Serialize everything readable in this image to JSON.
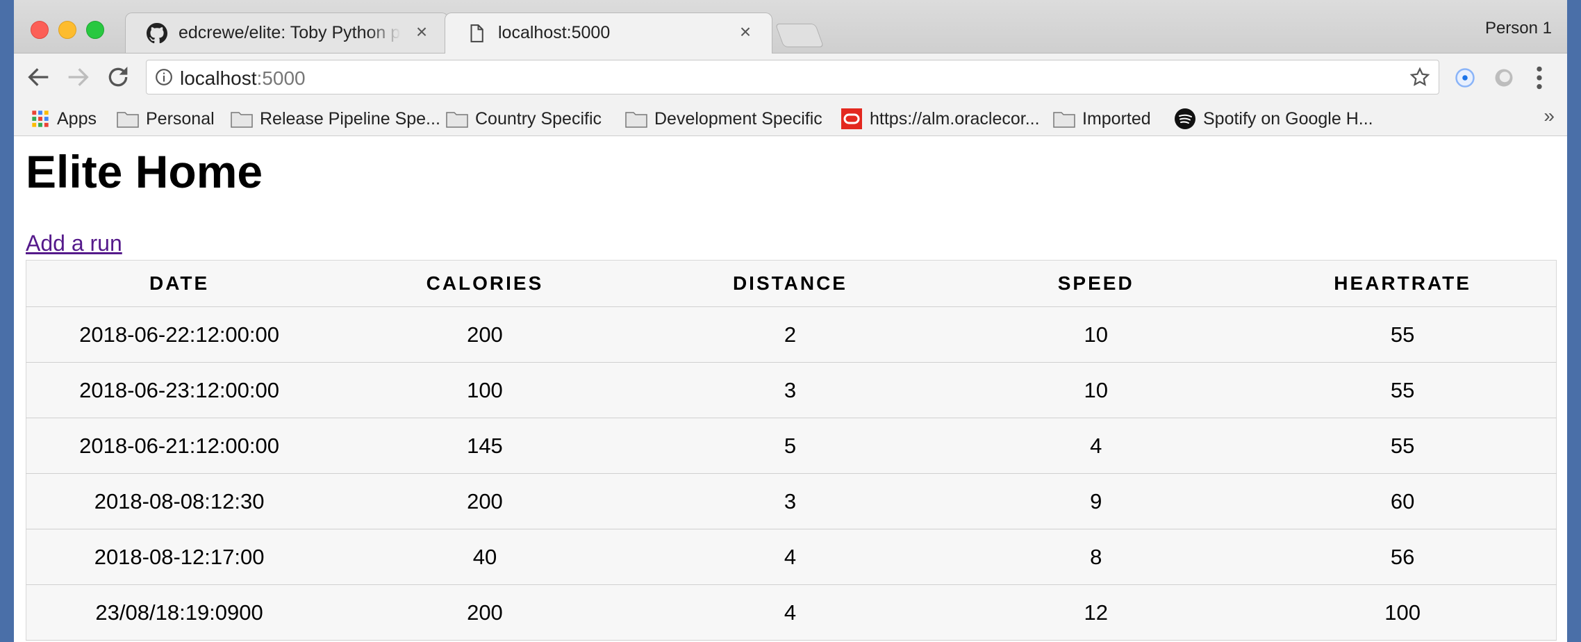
{
  "browser": {
    "tabs": [
      {
        "title": "edcrewe/elite: Toby Python pro",
        "icon": "github-icon",
        "active": false
      },
      {
        "title": "localhost:5000",
        "icon": "page-icon",
        "active": true
      }
    ],
    "profile_name": "Person 1",
    "address": {
      "host": "localhost",
      "port": ":5000"
    },
    "bookmarks": [
      {
        "label": "Apps",
        "icon": "apps-grid-icon"
      },
      {
        "label": "Personal",
        "icon": "folder-icon"
      },
      {
        "label": "Release Pipeline Spe...",
        "icon": "folder-icon"
      },
      {
        "label": "Country Specific",
        "icon": "folder-icon"
      },
      {
        "label": "Development Specific",
        "icon": "folder-icon"
      },
      {
        "label": "https://alm.oraclecor...",
        "icon": "oracle-icon"
      },
      {
        "label": "Imported",
        "icon": "folder-icon"
      },
      {
        "label": "Spotify on Google H...",
        "icon": "spotify-icon"
      }
    ],
    "bookmarks_overflow": "»"
  },
  "page": {
    "title": "Elite Home",
    "add_run_link": "Add a run",
    "table": {
      "headers": [
        "DATE",
        "CALORIES",
        "DISTANCE",
        "SPEED",
        "HEARTRATE"
      ],
      "rows": [
        [
          "2018-06-22:12:00:00",
          "200",
          "2",
          "10",
          "55"
        ],
        [
          "2018-06-23:12:00:00",
          "100",
          "3",
          "10",
          "55"
        ],
        [
          "2018-06-21:12:00:00",
          "145",
          "5",
          "4",
          "55"
        ],
        [
          "2018-08-08:12:30",
          "200",
          "3",
          "9",
          "60"
        ],
        [
          "2018-08-12:17:00",
          "40",
          "4",
          "8",
          "56"
        ],
        [
          "23/08/18:19:0900",
          "200",
          "4",
          "12",
          "100"
        ]
      ]
    }
  },
  "colors": {
    "link_visited": "#551a8b",
    "table_bg": "#f7f7f7",
    "desktop_bg": "#4a6fa8"
  }
}
